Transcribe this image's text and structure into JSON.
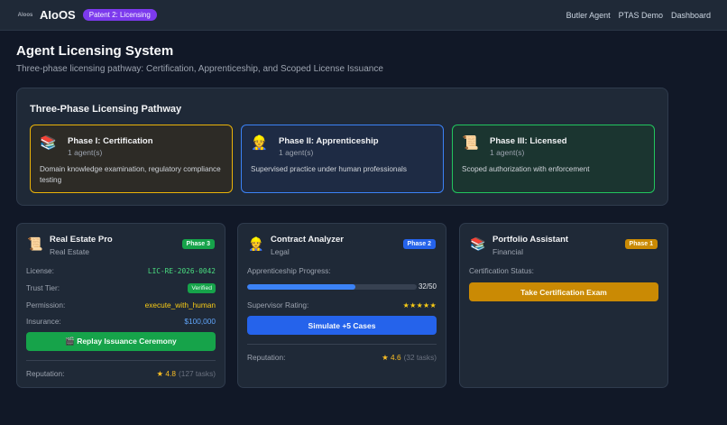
{
  "header": {
    "logo_text": "Aloos",
    "app_name": "AIoOS",
    "badge": "Patent 2: Licensing",
    "nav": [
      "Butler Agent",
      "PTAS Demo",
      "Dashboard"
    ]
  },
  "page": {
    "title": "Agent Licensing System",
    "subtitle": "Three-phase licensing pathway: Certification, Apprenticeship, and Scoped License Issuance"
  },
  "pathway": {
    "title": "Three-Phase Licensing Pathway",
    "phases": [
      {
        "icon": "books-icon",
        "glyph": "📚",
        "name": "Phase I: Certification",
        "count": "1 agent(s)",
        "description": "Domain knowledge examination, regulatory compliance testing",
        "color": "#eab308"
      },
      {
        "icon": "worker-icon",
        "glyph": "👷",
        "name": "Phase II: Apprenticeship",
        "count": "1 agent(s)",
        "description": "Supervised practice under human professionals",
        "color": "#3b82f6"
      },
      {
        "icon": "scroll-icon",
        "glyph": "📜",
        "name": "Phase III: Licensed",
        "count": "1 agent(s)",
        "description": "Scoped authorization with enforcement",
        "color": "#22c55e"
      }
    ]
  },
  "agents": [
    {
      "icon": "scroll-icon",
      "glyph": "📜",
      "name": "Real Estate Pro",
      "domain": "Real Estate",
      "phase": "Phase 3",
      "license_label": "License:",
      "license_value": "LIC-RE-2026-0042",
      "trust_label": "Trust Tier:",
      "trust_value": "Verified",
      "permission_label": "Permission:",
      "permission_value": "execute_with_human",
      "insurance_label": "Insurance:",
      "insurance_value": "$100,000",
      "button": "🎬 Replay Issuance Ceremony",
      "reputation_label": "Reputation:",
      "reputation_value": "★ 4.8",
      "reputation_tasks": "(127 tasks)"
    },
    {
      "icon": "worker-icon",
      "glyph": "👷",
      "name": "Contract Analyzer",
      "domain": "Legal",
      "phase": "Phase 2",
      "progress_label": "Apprenticeship Progress:",
      "progress_value": "32/50",
      "progress_fraction": 0.64,
      "rating_label": "Supervisor Rating:",
      "rating_value": "★★★★★",
      "button": "Simulate +5 Cases",
      "reputation_label": "Reputation:",
      "reputation_value": "★ 4.6",
      "reputation_tasks": "(32 tasks)"
    },
    {
      "icon": "books-icon",
      "glyph": "📚",
      "name": "Portfolio Assistant",
      "domain": "Financial",
      "phase": "Phase 1",
      "status_label": "Certification Status:",
      "button": "Take Certification Exam"
    }
  ]
}
